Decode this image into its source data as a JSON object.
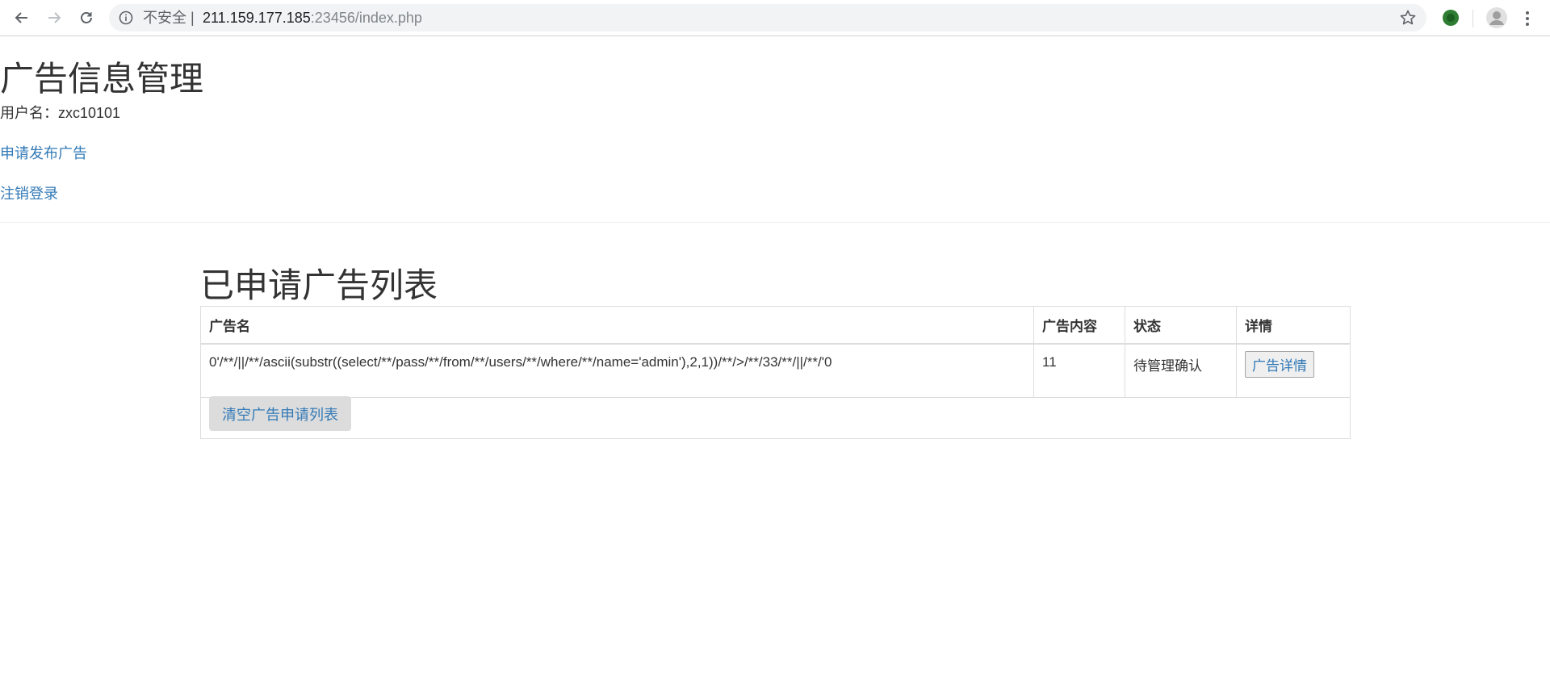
{
  "browser": {
    "security_label": "不安全",
    "url_host": "211.159.177.185",
    "url_rest": ":23456/index.php"
  },
  "page": {
    "title": "广告信息管理",
    "user_label": "用户名：",
    "username": "zxc10101",
    "apply_link": "申请发布广告",
    "logout_link": "注销登录"
  },
  "list": {
    "title": "已申请广告列表",
    "columns": [
      "广告名",
      "广告内容",
      "状态",
      "详情"
    ],
    "rows": [
      {
        "name": "0'/**/||/**/ascii(substr((select/**/pass/**/from/**/users/**/where/**/name='admin'),2,1))/**/>/**/33/**/||/**/'0",
        "content": "11",
        "status": "待管理确认",
        "detail_button": "广告详情"
      }
    ],
    "clear_button": "清空广告申请列表"
  },
  "colors": {
    "link": "#337ab7",
    "text": "#333333",
    "omnibox_bg": "#f1f3f4"
  }
}
